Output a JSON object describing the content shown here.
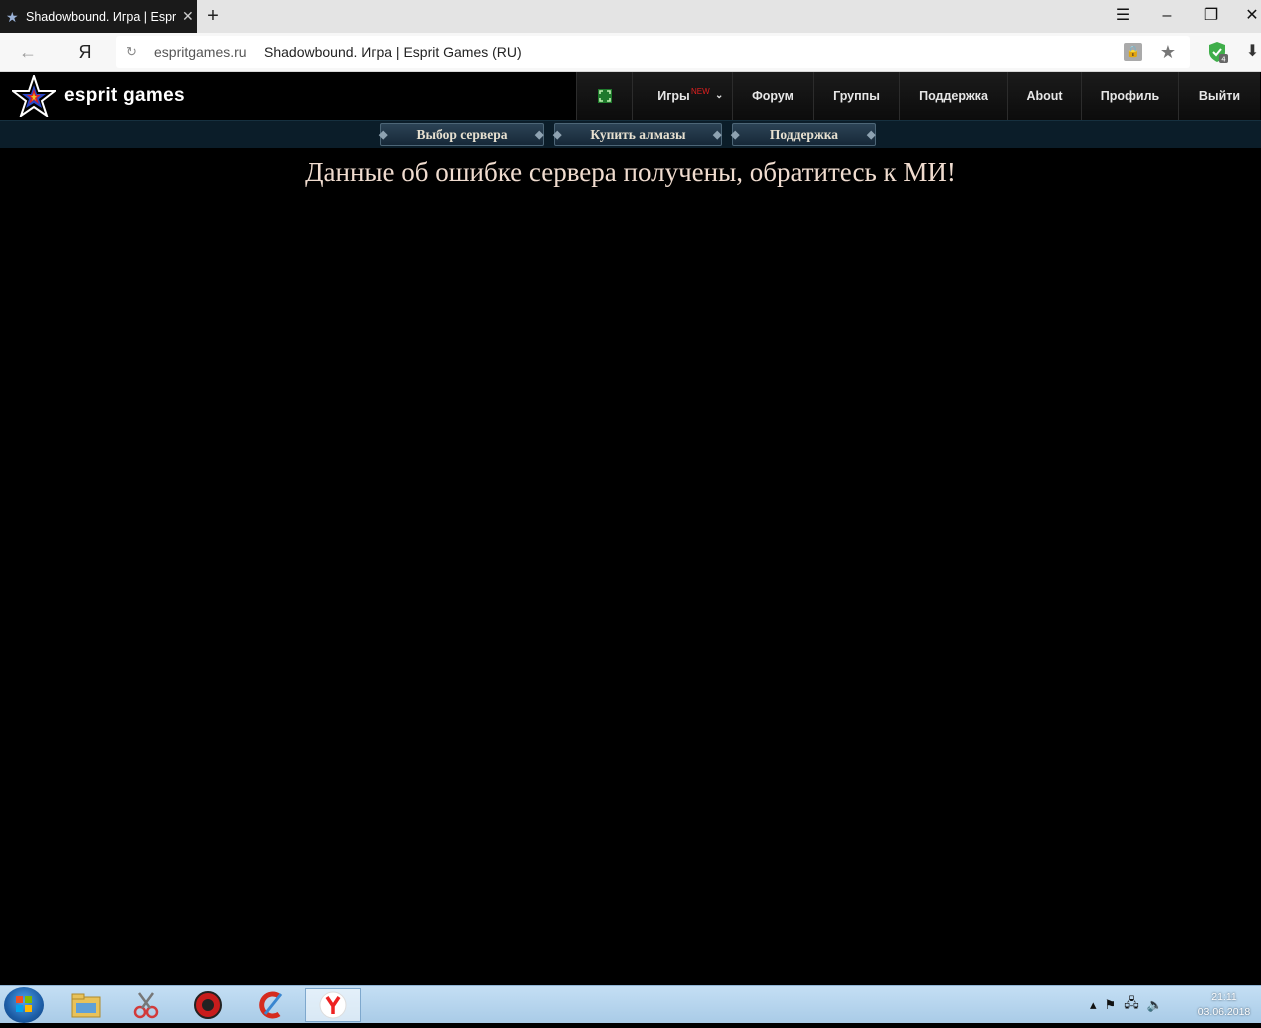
{
  "browser": {
    "tab_title": "Shadowbound. Игра | Esprit Games (RU)",
    "tab_close": "✕",
    "new_tab": "+",
    "url_domain": "espritgames.ru",
    "url_title": "Shadowbound. Игра | Esprit Games (RU)",
    "ya_label": "Я",
    "protect_badge": "4"
  },
  "site": {
    "logo_text": "esprit games",
    "nav": [
      {
        "label": "",
        "icon": "fullscreen-icon"
      },
      {
        "label": "Игры",
        "badge": "NEW"
      },
      {
        "label": "Форум"
      },
      {
        "label": "Группы"
      },
      {
        "label": "Поддержка"
      },
      {
        "label": "About"
      },
      {
        "label": "Профиль"
      },
      {
        "label": "Выйти"
      }
    ],
    "subnav": [
      {
        "label": "Выбор сервера"
      },
      {
        "label": "Купить алмазы"
      },
      {
        "label": "Поддержка"
      }
    ],
    "error_message": "Данные об ошибке сервера получены, обратитесь к МИ!"
  },
  "taskbar": {
    "time": "21:11",
    "date": "03.06.2018"
  },
  "colors": {
    "accent_red": "#e02020",
    "page_bg": "#000000",
    "subbar_bg": "#0b1d29",
    "error_text": "#f0dccf"
  }
}
